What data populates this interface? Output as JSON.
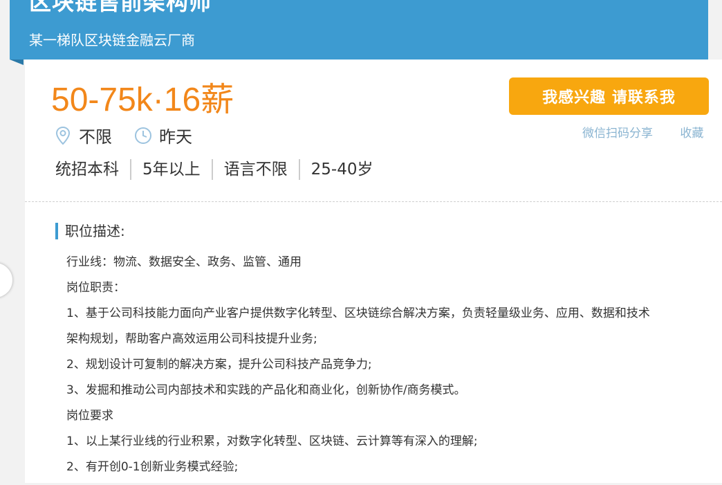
{
  "header": {
    "title": "区块链售前架构师",
    "company": "某一梯队区块链金融云厂商"
  },
  "job": {
    "salary": "50-75k·16薪",
    "location": "不限",
    "posted": "昨天",
    "tags": [
      "统招本科",
      "5年以上",
      "语言不限",
      "25-40岁"
    ]
  },
  "actions": {
    "interest_label": "我感兴趣 请联系我",
    "share_label": "微信扫码分享",
    "favorite_label": "收藏"
  },
  "description": {
    "title": "职位描述:",
    "lines": [
      "行业线：物流、数据安全、政务、监管、通用",
      "岗位职责：",
      "1、基于公司科技能力面向产业客户提供数字化转型、区块链综合解决方案，负责轻量级业务、应用、数据和技术",
      "架构规划，帮助客户高效运用公司科技提升业务;",
      "2、规划设计可复制的解决方案，提升公司科技产品竞争力;",
      "3、发掘和推动公司内部技术和实践的产品化和商业化，创新协作/商务模式。",
      "岗位要求",
      "1、以上某行业线的行业积累，对数字化转型、区块链、云计算等有深入的理解;",
      "2、有开创0-1创新业务模式经验;"
    ]
  },
  "colors": {
    "header_bg": "#3d9bd1",
    "salary": "#f2871a",
    "button": "#f8a70f",
    "link": "#8ab4d1"
  }
}
